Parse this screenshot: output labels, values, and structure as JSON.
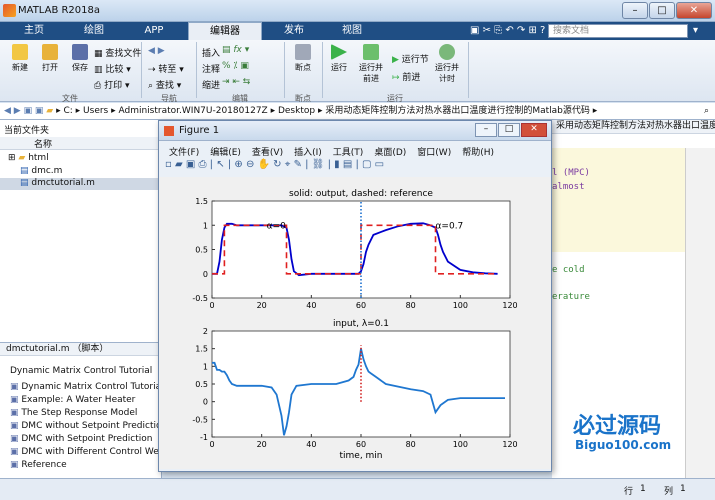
{
  "app": {
    "title": "MATLAB R2018a"
  },
  "tabs": [
    "主页",
    "绘图",
    "APP",
    "编辑器",
    "发布",
    "视图"
  ],
  "search": {
    "placeholder": "搜索文档"
  },
  "ribbon": {
    "file": {
      "new": "新建",
      "open": "打开",
      "save": "保存",
      "find_files": "查找文件",
      "compare": "比较",
      "print": "打印",
      "group": "文件"
    },
    "nav": {
      "goto": "转至",
      "find": "查找",
      "group": "导航"
    },
    "edit": {
      "insert": "插入",
      "comment": "注释",
      "indent": "缩进",
      "fx": "fx",
      "group": "编辑"
    },
    "breakpoints": {
      "label": "断点",
      "group": "断点"
    },
    "run": {
      "run": "运行",
      "run_advance": "运行并前进",
      "run_section": "运行节",
      "advance": "前进",
      "run_time": "运行并计时",
      "group": "运行"
    }
  },
  "address": {
    "path": [
      "C:",
      "Users",
      "Administrator.WIN7U-20180127Z",
      "Desktop",
      "采用动态矩阵控制方法对热水器出口温度进行控制的Matlab源代码"
    ]
  },
  "current_folder": {
    "title": "当前文件夹",
    "col": "名称",
    "items": [
      "html",
      "dmc.m",
      "dmctutorial.m"
    ]
  },
  "details": {
    "title": "dmctutorial.m （脚本）",
    "outline": [
      "Dynamic Matrix Control Tutorial",
      "Dynamic Matrix Control Tutorial",
      "Example: A Water Heater",
      "The Step Response Model",
      "DMC without Setpoint Prediction",
      "DMC with Setpoint Prediction",
      "DMC with Different Control We...",
      "Reference"
    ]
  },
  "editor": {
    "header": "采用动态矩阵控制方法对热水器出口温度进行控制的Matlab源代码",
    "lines": [
      "l (MPC)",
      "almost",
      "e cold",
      "erature"
    ]
  },
  "status": {
    "line_label": "行",
    "line": "1",
    "col_label": "列",
    "col": "1"
  },
  "watermark": {
    "cn": "必过源码",
    "url": "Biguo100.com"
  },
  "figure": {
    "title": "Figure 1",
    "menu": [
      "文件(F)",
      "编辑(E)",
      "查看(V)",
      "插入(I)",
      "工具(T)",
      "桌面(D)",
      "窗口(W)",
      "帮助(H)"
    ],
    "chart_data": [
      {
        "type": "line",
        "title": "solid: output, dashed: reference",
        "xlim": [
          0,
          120
        ],
        "ylim": [
          -0.5,
          1.5
        ],
        "xticks": [
          0,
          20,
          40,
          60,
          80,
          100,
          120
        ],
        "yticks": [
          -0.5,
          0,
          0.5,
          1,
          1.5
        ],
        "annotations": [
          {
            "text": "α=0",
            "x": 22,
            "y": 1
          },
          {
            "text": "α=0.7",
            "x": 90,
            "y": 1
          }
        ],
        "series": [
          {
            "style": "solid",
            "color": "#0000cc",
            "x": [
              0,
              2,
              3,
              4,
              5,
              6,
              8,
              10,
              15,
              20,
              25,
              28,
              30,
              31,
              32,
              33,
              35,
              40,
              45,
              50,
              55,
              59,
              60,
              61,
              62,
              63,
              65,
              70,
              75,
              80,
              85,
              88,
              90,
              91,
              92,
              93,
              95,
              100,
              105,
              110,
              115
            ],
            "y": [
              0,
              0,
              0.25,
              0.7,
              0.95,
              1.03,
              1.03,
              1.0,
              1.0,
              1.0,
              1.0,
              1.0,
              0.95,
              0.7,
              0.3,
              0.05,
              -0.03,
              0,
              0,
              0,
              0,
              0,
              0.05,
              0.2,
              0.45,
              0.6,
              0.8,
              0.9,
              0.98,
              1.03,
              1.04,
              1.0,
              0.95,
              0.8,
              0.6,
              0.45,
              0.25,
              0.08,
              0.03,
              0.01,
              0
            ]
          },
          {
            "style": "dashed",
            "color": "#e02020",
            "x": [
              0,
              5,
              5,
              30,
              30,
              60,
              60,
              90,
              90,
              115
            ],
            "y": [
              0,
              0,
              1,
              1,
              0,
              0,
              1,
              1,
              0,
              0
            ]
          },
          {
            "style": "dotted",
            "color": "#1a6fd0",
            "x": [
              60,
              60
            ],
            "y": [
              -0.5,
              1.5
            ]
          }
        ]
      },
      {
        "type": "line",
        "title": "input, λ=0.1",
        "xlabel": "time, min",
        "xlim": [
          0,
          120
        ],
        "ylim": [
          -1,
          2
        ],
        "xticks": [
          0,
          20,
          40,
          60,
          80,
          100,
          120
        ],
        "yticks": [
          -1,
          -0.5,
          0,
          0.5,
          1,
          1.5,
          2
        ],
        "series": [
          {
            "style": "solid",
            "color": "#1f77d0",
            "x": [
              0,
              1,
              2,
              3,
              4,
              5,
              6,
              7,
              8,
              10,
              15,
              20,
              24,
              26,
              28,
              29,
              30,
              31,
              32,
              34,
              40,
              50,
              55,
              57,
              58,
              59,
              60,
              61,
              62,
              63,
              64,
              66,
              70,
              80,
              85,
              88,
              90,
              92,
              95,
              100,
              110,
              118
            ],
            "y": [
              1.1,
              1.1,
              0.9,
              0.9,
              0.85,
              0.85,
              0.75,
              0.6,
              0.5,
              0.45,
              0.45,
              0.45,
              0.4,
              0.2,
              -0.4,
              -0.95,
              -0.7,
              -0.3,
              0.2,
              0.45,
              0.5,
              0.5,
              0.6,
              0.7,
              0.9,
              1.05,
              1.5,
              1.2,
              1.0,
              0.85,
              0.8,
              0.7,
              0.5,
              0.35,
              0.3,
              0.2,
              -0.3,
              -0.1,
              0.05,
              0.1,
              0.1,
              0.1
            ]
          },
          {
            "style": "dotted",
            "color": "#d02020",
            "x": [
              60,
              60
            ],
            "y": [
              0,
              1.6
            ]
          }
        ]
      }
    ]
  }
}
